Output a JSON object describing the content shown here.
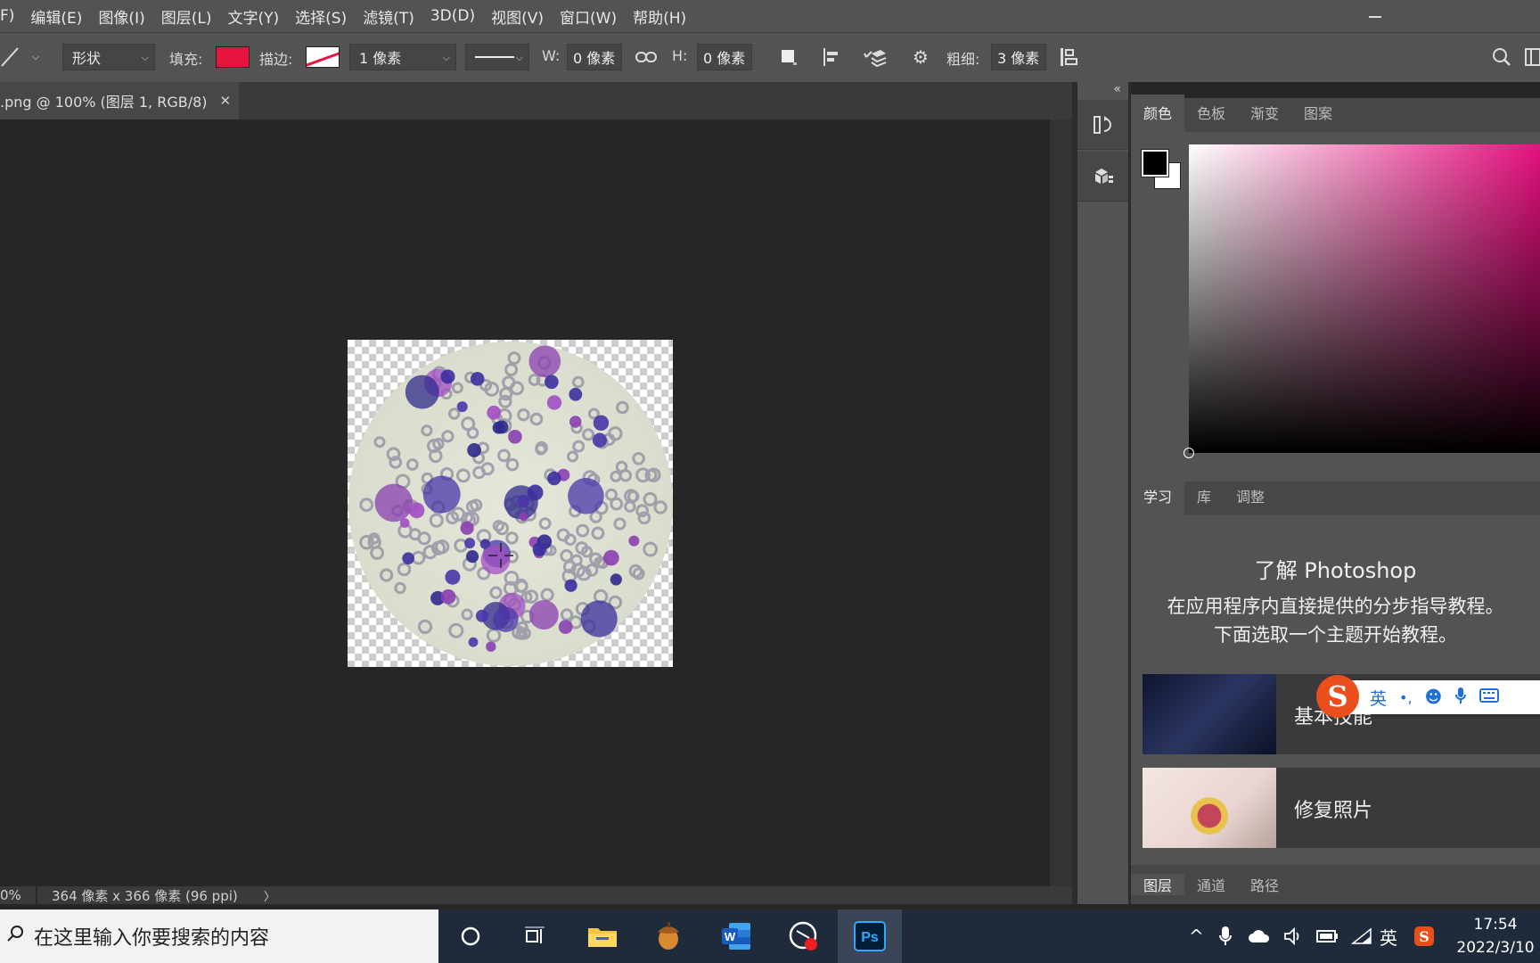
{
  "menu": [
    "F)",
    "编辑(E)",
    "图像(I)",
    "图层(L)",
    "文字(Y)",
    "选择(S)",
    "滤镜(T)",
    "3D(D)",
    "视图(V)",
    "窗口(W)",
    "帮助(H)"
  ],
  "options": {
    "mode": "形状",
    "fill_label": "填充:",
    "stroke_label": "描边:",
    "stroke_width": "1 像素",
    "w_label": "W:",
    "w_value": "0 像素",
    "h_label": "H:",
    "h_value": "0 像素",
    "weight_label": "粗细:",
    "weight_value": "3 像素",
    "fill_color": "#e8133f"
  },
  "document": {
    "tab_title": ".png @ 100% (图层 1, RGB/8)",
    "status_zoom": "0%",
    "status_info": "364 像素 x 366 像素 (96 ppi)"
  },
  "color_panel": {
    "tabs": [
      "颜色",
      "色板",
      "渐变",
      "图案"
    ],
    "hue_color": "#e6117f"
  },
  "learn_panel": {
    "tabs": [
      "学习",
      "库",
      "调整"
    ],
    "title": "了解 Photoshop",
    "desc_line1": "在应用程序内直接提供的分步指导教程。",
    "desc_line2": "下面选取一个主题开始教程。",
    "cards": [
      "基本技能",
      "修复照片"
    ]
  },
  "layers_panel": {
    "tabs": [
      "图层",
      "通道",
      "路径"
    ]
  },
  "ime": {
    "mode": "英"
  },
  "taskbar": {
    "search_placeholder": "在这里输入你要搜索的内容",
    "ps_label": "Ps",
    "word_label": "W",
    "ime_indicator": "英",
    "time": "17:54",
    "date": "2022/3/10"
  }
}
